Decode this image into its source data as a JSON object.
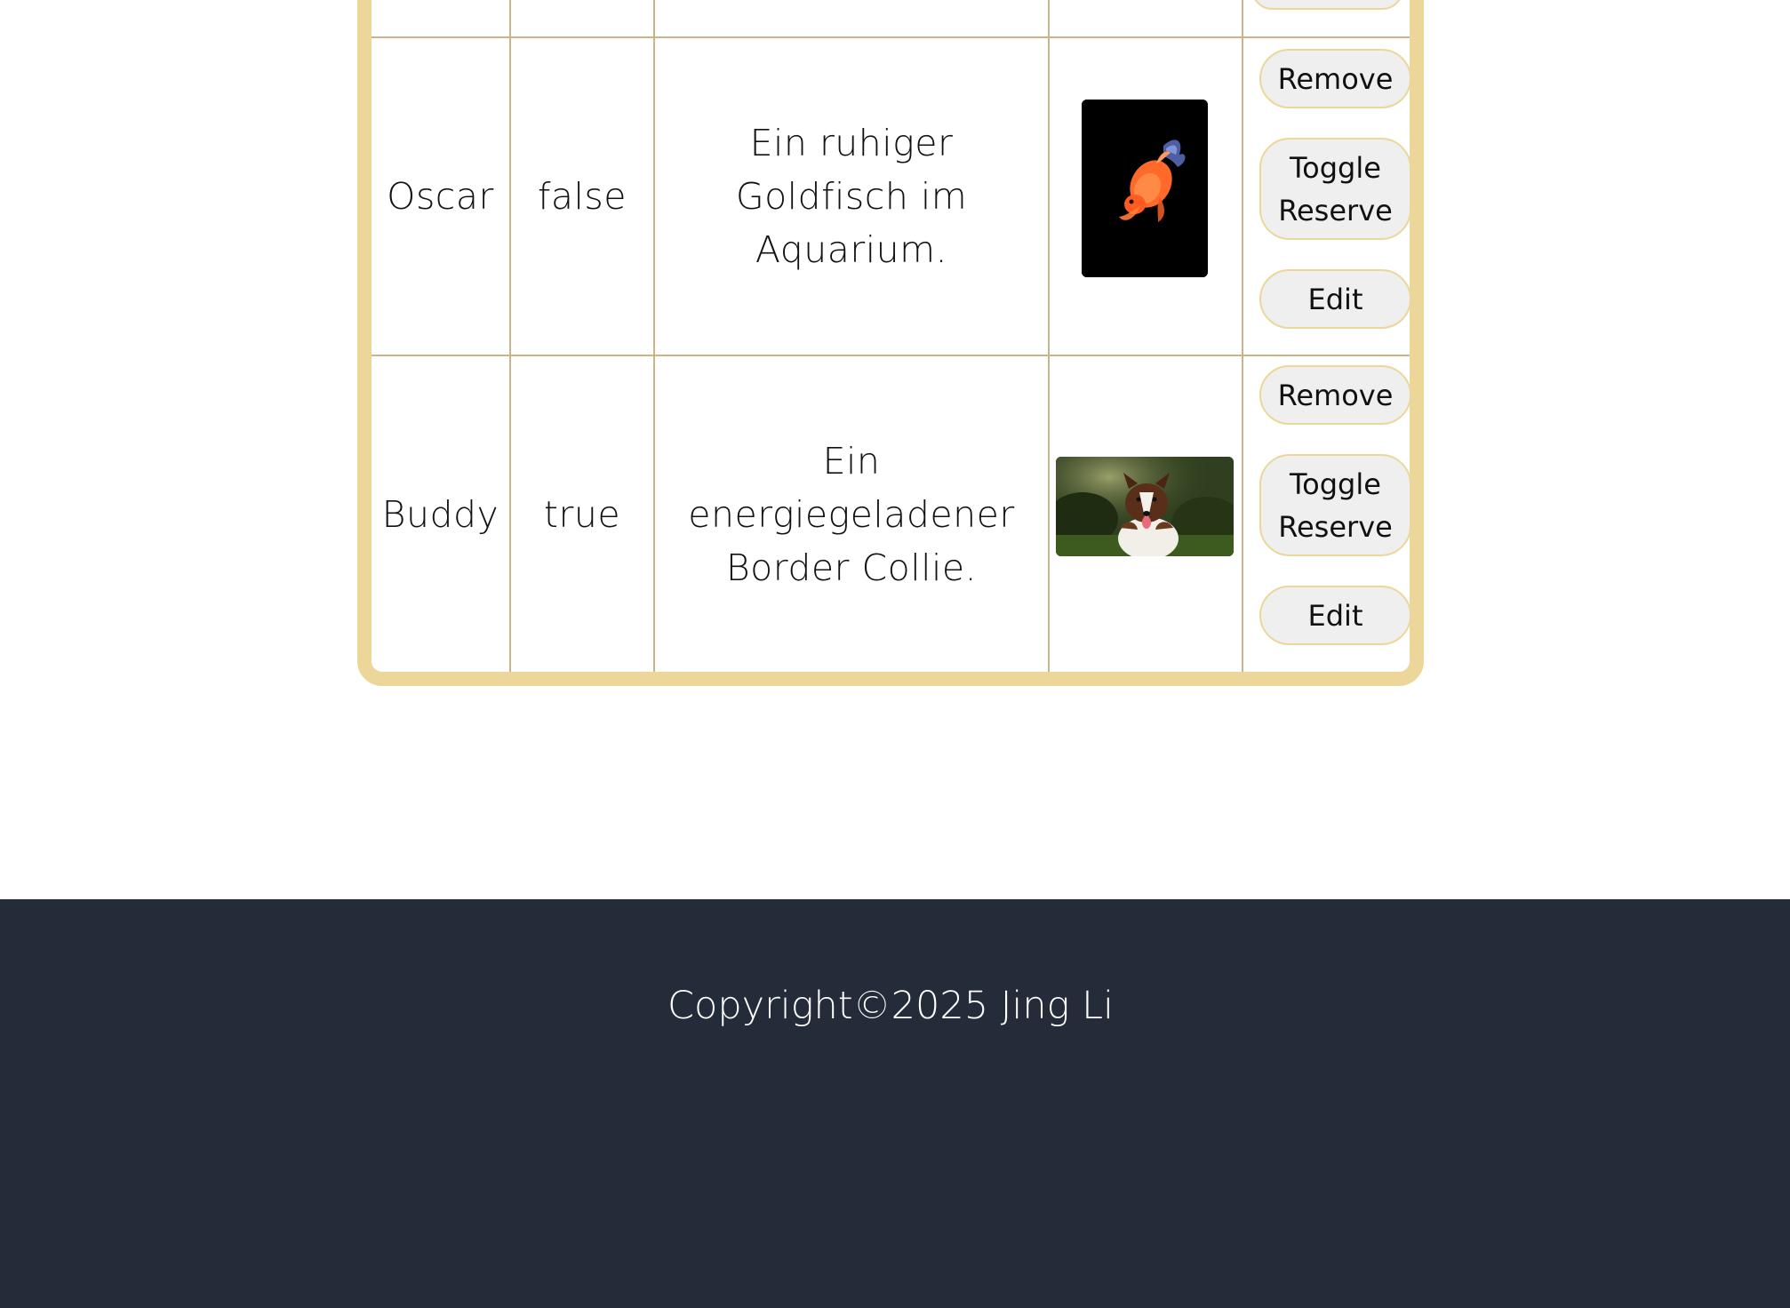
{
  "table": {
    "rows": [
      {
        "name": "Oscar",
        "reserved": "false",
        "description": "Ein ruhiger Goldfisch im Aquarium.",
        "image_alt": "goldfish-photo",
        "actions": {
          "remove": "Remove",
          "toggle": "Toggle Reserve",
          "edit": "Edit"
        }
      },
      {
        "name": "Buddy",
        "reserved": "true",
        "description": "Ein energiegeladener Border Collie.",
        "image_alt": "border-collie-photo",
        "actions": {
          "remove": "Remove",
          "toggle": "Toggle Reserve",
          "edit": "Edit"
        }
      }
    ]
  },
  "footer": {
    "copyright": "Copyright©2025 Jing Li"
  },
  "colors": {
    "table_border": "#ecd699",
    "grid_line": "#c9b588",
    "button_bg": "#efefef",
    "footer_bg": "#232c38"
  }
}
